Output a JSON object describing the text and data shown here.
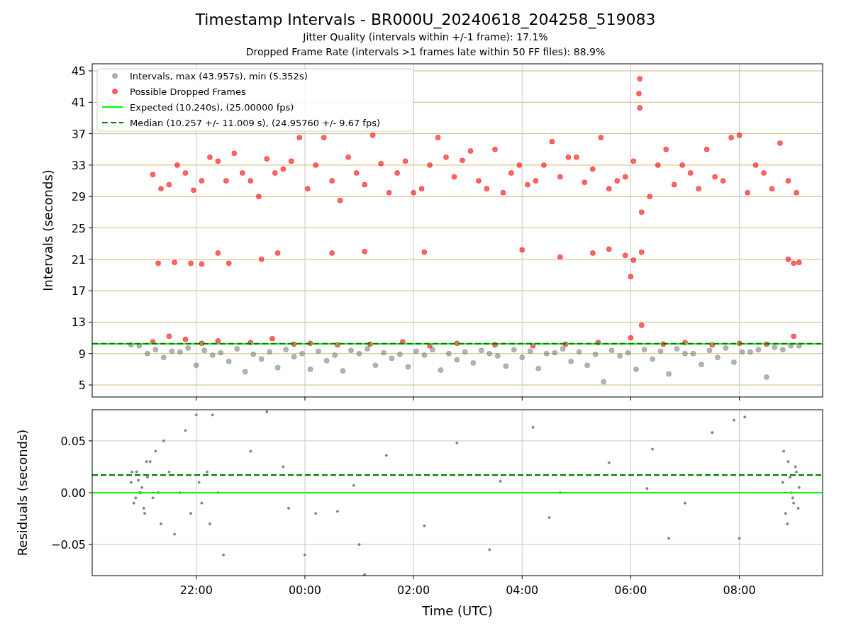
{
  "figure": {
    "title": "Timestamp Intervals - BR000U_20240618_204258_519083",
    "subtitles": [
      "Jitter Quality (intervals within +/-1 frame): 17.1%",
      "Dropped Frame Rate (intervals >1 frames late within 50 FF files): 88.9%"
    ],
    "charts": [
      {
        "chart_data": {
          "type": "scatter",
          "ylabel": "Intervals (seconds)",
          "grid": true,
          "xlim": [
            "2024-06-18T20:05",
            "2024-06-19T09:32"
          ],
          "ylim": [
            3.47,
            45.9
          ],
          "yticks": [
            {
              "value": 45,
              "label": "45"
            },
            {
              "value": 41,
              "label": "41"
            },
            {
              "value": 37,
              "label": "37"
            },
            {
              "value": 33,
              "label": "33"
            },
            {
              "value": 29,
              "label": "29"
            },
            {
              "value": 25,
              "label": "25"
            },
            {
              "value": 21,
              "label": "21"
            },
            {
              "value": 17,
              "label": "17"
            },
            {
              "value": 13,
              "label": "13"
            },
            {
              "value": 9,
              "label": "9"
            },
            {
              "value": 5,
              "label": "5"
            }
          ],
          "legend": true,
          "series": [
            {
              "name": "Intervals, max (43.957s), min (5.352s)",
              "type": "scatter",
              "color": "#808080",
              "x": [
                "2024-06-18T20:48",
                "2024-06-18T21:06",
                "2024-06-18T21:24",
                "2024-06-18T21:42",
                "2024-06-18T22:00",
                "2024-06-18T22:18",
                "2024-06-18T22:36",
                "2024-06-18T22:54",
                "2024-06-18T23:12",
                "2024-06-18T23:30",
                "2024-06-18T23:48",
                "2024-06-19T00:06",
                "2024-06-19T00:24",
                "2024-06-19T00:42",
                "2024-06-19T01:00",
                "2024-06-19T01:18",
                "2024-06-19T01:36",
                "2024-06-19T01:54",
                "2024-06-19T02:12",
                "2024-06-19T02:30",
                "2024-06-19T02:48",
                "2024-06-19T03:06",
                "2024-06-19T03:24",
                "2024-06-19T03:42",
                "2024-06-19T04:00",
                "2024-06-19T04:18",
                "2024-06-19T04:36",
                "2024-06-19T04:54",
                "2024-06-19T05:12",
                "2024-06-19T05:30",
                "2024-06-19T05:48",
                "2024-06-19T06:06",
                "2024-06-19T06:24",
                "2024-06-19T06:42",
                "2024-06-19T07:00",
                "2024-06-19T07:18",
                "2024-06-19T07:36",
                "2024-06-19T07:54",
                "2024-06-19T08:12",
                "2024-06-19T08:30",
                "2024-06-19T08:48",
                "2024-06-19T09:06",
                "2024-06-18T20:57",
                "2024-06-18T21:15",
                "2024-06-18T21:33",
                "2024-06-18T21:51",
                "2024-06-18T22:09",
                "2024-06-18T22:27",
                "2024-06-18T22:45",
                "2024-06-18T23:03",
                "2024-06-18T23:21",
                "2024-06-18T23:39",
                "2024-06-18T23:57",
                "2024-06-19T00:15",
                "2024-06-19T00:33",
                "2024-06-19T00:51",
                "2024-06-19T01:09",
                "2024-06-19T01:27",
                "2024-06-19T01:45",
                "2024-06-19T02:03",
                "2024-06-19T02:21",
                "2024-06-19T02:39",
                "2024-06-19T02:57",
                "2024-06-19T03:15",
                "2024-06-19T03:33",
                "2024-06-19T03:51",
                "2024-06-19T04:09",
                "2024-06-19T04:27",
                "2024-06-19T04:45",
                "2024-06-19T05:03",
                "2024-06-19T05:21",
                "2024-06-19T05:39",
                "2024-06-19T05:57",
                "2024-06-19T06:15",
                "2024-06-19T06:33",
                "2024-06-19T06:51",
                "2024-06-19T07:09",
                "2024-06-19T07:27",
                "2024-06-19T07:45",
                "2024-06-19T08:03",
                "2024-06-19T08:21",
                "2024-06-19T08:39",
                "2024-06-19T08:57"
              ],
              "values": [
                10.1,
                9.0,
                8.5,
                9.2,
                7.5,
                8.8,
                8.0,
                6.7,
                8.3,
                7.2,
                8.6,
                7.0,
                8.1,
                6.8,
                9.0,
                7.5,
                8.4,
                7.3,
                8.8,
                6.9,
                8.2,
                7.8,
                9.0,
                7.4,
                8.5,
                7.1,
                9.1,
                8.0,
                7.5,
                5.4,
                8.7,
                7.0,
                8.3,
                6.4,
                9.0,
                7.6,
                8.5,
                7.9,
                9.2,
                6.0,
                9.5,
                10.0,
                10.0,
                9.5,
                9.3,
                9.7,
                9.4,
                9.1,
                9.6,
                8.9,
                9.2,
                9.5,
                9.0,
                9.3,
                8.8,
                9.4,
                9.6,
                9.1,
                8.9,
                9.3,
                9.5,
                9.0,
                9.2,
                9.4,
                8.7,
                9.5,
                9.3,
                9.0,
                9.6,
                9.2,
                8.9,
                9.4,
                9.1,
                9.5,
                9.3,
                9.6,
                9.0,
                9.4,
                9.7,
                9.2,
                9.5,
                9.8,
                10.0
              ]
            },
            {
              "name": "Possible Dropped Frames",
              "type": "scatter",
              "color": "#ff0000",
              "x": [
                "2024-06-18T21:12",
                "2024-06-18T21:30",
                "2024-06-18T21:48",
                "2024-06-18T22:06",
                "2024-06-18T22:24",
                "2024-06-18T22:42",
                "2024-06-18T23:00",
                "2024-06-18T23:18",
                "2024-06-18T23:36",
                "2024-06-18T23:54",
                "2024-06-19T00:12",
                "2024-06-19T00:30",
                "2024-06-19T00:48",
                "2024-06-19T01:06",
                "2024-06-19T01:24",
                "2024-06-19T01:42",
                "2024-06-19T02:00",
                "2024-06-19T02:18",
                "2024-06-19T02:36",
                "2024-06-19T02:54",
                "2024-06-19T03:12",
                "2024-06-19T03:30",
                "2024-06-19T03:48",
                "2024-06-19T04:06",
                "2024-06-19T04:24",
                "2024-06-19T04:42",
                "2024-06-19T05:00",
                "2024-06-19T05:18",
                "2024-06-19T05:36",
                "2024-06-19T05:54",
                "2024-06-19T06:12",
                "2024-06-19T06:30",
                "2024-06-19T06:48",
                "2024-06-19T07:06",
                "2024-06-19T07:24",
                "2024-06-19T07:42",
                "2024-06-19T08:00",
                "2024-06-19T08:18",
                "2024-06-19T08:36",
                "2024-06-19T08:54",
                "2024-06-18T21:21",
                "2024-06-18T21:39",
                "2024-06-18T21:57",
                "2024-06-18T22:15",
                "2024-06-18T22:33",
                "2024-06-18T22:51",
                "2024-06-18T23:09",
                "2024-06-18T23:27",
                "2024-06-18T23:45",
                "2024-06-19T00:03",
                "2024-06-19T00:21",
                "2024-06-19T00:39",
                "2024-06-19T00:57",
                "2024-06-19T01:15",
                "2024-06-19T01:33",
                "2024-06-19T01:51",
                "2024-06-19T02:09",
                "2024-06-19T02:27",
                "2024-06-19T02:45",
                "2024-06-19T03:03",
                "2024-06-19T03:21",
                "2024-06-19T03:39",
                "2024-06-19T03:57",
                "2024-06-19T04:15",
                "2024-06-19T04:33",
                "2024-06-19T04:51",
                "2024-06-19T05:09",
                "2024-06-19T05:27",
                "2024-06-19T05:45",
                "2024-06-19T06:03",
                "2024-06-19T06:21",
                "2024-06-19T06:39",
                "2024-06-19T06:57",
                "2024-06-19T07:15",
                "2024-06-19T07:33",
                "2024-06-19T07:51",
                "2024-06-19T08:09",
                "2024-06-19T08:27",
                "2024-06-19T08:45",
                "2024-06-19T09:03",
                "2024-06-18T21:18",
                "2024-06-18T21:36",
                "2024-06-18T21:54",
                "2024-06-18T22:06",
                "2024-06-18T22:24",
                "2024-06-18T22:36",
                "2024-06-18T23:12",
                "2024-06-18T23:30",
                "2024-06-19T00:30",
                "2024-06-19T01:06",
                "2024-06-19T02:12",
                "2024-06-19T04:00",
                "2024-06-19T04:42",
                "2024-06-19T05:18",
                "2024-06-19T05:36",
                "2024-06-19T05:54",
                "2024-06-19T06:00",
                "2024-06-19T06:12",
                "2024-06-19T06:03",
                "2024-06-19T09:00",
                "2024-06-19T08:54",
                "2024-06-19T09:06",
                "2024-06-18T21:12",
                "2024-06-18T21:30",
                "2024-06-18T21:48",
                "2024-06-18T22:06",
                "2024-06-18T22:24",
                "2024-06-18T23:00",
                "2024-06-18T23:24",
                "2024-06-18T23:48",
                "2024-06-19T00:06",
                "2024-06-19T00:36",
                "2024-06-19T01:12",
                "2024-06-19T01:48",
                "2024-06-19T02:18",
                "2024-06-19T02:48",
                "2024-06-19T03:30",
                "2024-06-19T04:12",
                "2024-06-19T04:48",
                "2024-06-19T05:24",
                "2024-06-19T06:00",
                "2024-06-19T06:12",
                "2024-06-19T06:36",
                "2024-06-19T07:00",
                "2024-06-19T07:30",
                "2024-06-19T08:00",
                "2024-06-19T08:30",
                "2024-06-19T09:00",
                "2024-06-19T06:10",
                "2024-06-19T06:09",
                "2024-06-19T06:10"
              ],
              "values": [
                31.8,
                30.5,
                32.0,
                31.0,
                33.5,
                34.5,
                31.0,
                33.8,
                32.5,
                36.5,
                33.0,
                31.0,
                34.0,
                30.5,
                33.2,
                32.0,
                29.5,
                33.0,
                34.0,
                33.6,
                31.0,
                35.0,
                32.0,
                30.5,
                33.0,
                31.5,
                34.0,
                32.5,
                30.0,
                31.5,
                27.0,
                33.0,
                30.5,
                32.0,
                35.0,
                31.0,
                36.8,
                33.0,
                30.0,
                31.0,
                30,
                33,
                29.8,
                34,
                31,
                32,
                29,
                32,
                33.5,
                30,
                36.5,
                28.5,
                32,
                36.8,
                29.5,
                33.5,
                30,
                36.5,
                31.5,
                34.8,
                30,
                29.5,
                33,
                31,
                36,
                34,
                30.8,
                36.5,
                31,
                33.5,
                29,
                35,
                33,
                30,
                31.5,
                36.5,
                29.5,
                32,
                35.8,
                29.5,
                20.5,
                20.6,
                20.5,
                20.4,
                21.8,
                20.5,
                21.0,
                21.8,
                21.8,
                22.0,
                21.9,
                22.2,
                21.3,
                21.8,
                22.3,
                21.5,
                18.8,
                21.9,
                20.9,
                20.5,
                21.0,
                20.6,
                10.5,
                11.2,
                10.8,
                10.3,
                10.6,
                10.4,
                10.9,
                10.2,
                10.3,
                10.1,
                10.2,
                10.5,
                10.0,
                10.3,
                10.1,
                10.0,
                10.2,
                10.4,
                11.0,
                12.6,
                10.2,
                10.4,
                10.1,
                10.3,
                10.2,
                11.2,
                44.0,
                42.1,
                40.3
              ]
            },
            {
              "name": "Expected (10.240s), (25.00000 fps)",
              "type": "line",
              "color": "#00ff00",
              "x": [
                "2024-06-18T20:05",
                "2024-06-19T09:32"
              ],
              "values": [
                10.24,
                10.24
              ]
            },
            {
              "name": "Median (10.257 +/- 11.009 s), (24.95760 +/- 9.67 fps)",
              "type": "line",
              "line_style": "dashed",
              "color": "#008000",
              "x": [
                "2024-06-18T20:05",
                "2024-06-19T09:32"
              ],
              "values": [
                10.257,
                10.257
              ]
            }
          ]
        }
      },
      {
        "chart_data": {
          "type": "scatter",
          "ylabel": "Residuals (seconds)",
          "xlabel": "Time (UTC)",
          "grid": true,
          "xlim": [
            "2024-06-18T20:05",
            "2024-06-19T09:32"
          ],
          "ylim": [
            -0.08,
            0.08
          ],
          "xticks": [
            {
              "value": "2024-06-18T22:00",
              "label": "22:00"
            },
            {
              "value": "2024-06-19T00:00",
              "label": "00:00"
            },
            {
              "value": "2024-06-19T02:00",
              "label": "02:00"
            },
            {
              "value": "2024-06-19T04:00",
              "label": "04:00"
            },
            {
              "value": "2024-06-19T06:00",
              "label": "06:00"
            },
            {
              "value": "2024-06-19T08:00",
              "label": "08:00"
            }
          ],
          "yticks": [
            {
              "value": 0.05,
              "label": "0.05"
            },
            {
              "value": 0,
              "label": "0.00"
            },
            {
              "value": -0.05,
              "label": "−0.05"
            }
          ],
          "legend": false,
          "series": [
            {
              "type": "scatter",
              "color": "#808080",
              "x": [
                "2024-06-18T20:48",
                "2024-06-18T20:51",
                "2024-06-18T20:54",
                "2024-06-18T20:57",
                "2024-06-18T21:00",
                "2024-06-18T21:03",
                "2024-06-18T21:06",
                "2024-06-18T21:09",
                "2024-06-18T21:12",
                "2024-06-18T21:15",
                "2024-06-18T21:18",
                "2024-06-18T21:21",
                "2024-06-18T21:24",
                "2024-06-18T21:30",
                "2024-06-18T21:36",
                "2024-06-18T21:42",
                "2024-06-18T21:48",
                "2024-06-18T21:54",
                "2024-06-18T22:00",
                "2024-06-18T22:03",
                "2024-06-18T22:06",
                "2024-06-18T22:12",
                "2024-06-18T22:15",
                "2024-06-18T22:18",
                "2024-06-18T22:24",
                "2024-06-18T22:30",
                "2024-06-18T23:00",
                "2024-06-18T23:18",
                "2024-06-18T23:36",
                "2024-06-18T23:42",
                "2024-06-19T00:00",
                "2024-06-19T00:12",
                "2024-06-19T00:36",
                "2024-06-19T00:54",
                "2024-06-19T01:00",
                "2024-06-19T01:06",
                "2024-06-19T01:30",
                "2024-06-19T02:12",
                "2024-06-19T02:48",
                "2024-06-19T03:24",
                "2024-06-19T03:36",
                "2024-06-19T04:12",
                "2024-06-19T04:30",
                "2024-06-19T04:42",
                "2024-06-19T05:36",
                "2024-06-19T06:18",
                "2024-06-19T06:24",
                "2024-06-19T06:42",
                "2024-06-19T07:00",
                "2024-06-19T07:30",
                "2024-06-19T07:54",
                "2024-06-19T08:06",
                "2024-06-19T08:00",
                "2024-06-19T08:48",
                "2024-06-19T08:51",
                "2024-06-19T08:54",
                "2024-06-19T08:57",
                "2024-06-19T09:00",
                "2024-06-19T09:03",
                "2024-06-19T09:06",
                "2024-06-19T08:49",
                "2024-06-19T08:53",
                "2024-06-19T08:56",
                "2024-06-19T08:59",
                "2024-06-19T09:02",
                "2024-06-19T09:05",
                "2024-06-18T20:49",
                "2024-06-18T20:53",
                "2024-06-18T20:56",
                "2024-06-18T20:59",
                "2024-06-18T21:02",
                "2024-06-18T21:05"
              ],
              "values": [
                0.01,
                -0.01,
                0.02,
                0.0,
                0.005,
                -0.02,
                0.015,
                0.03,
                -0.005,
                0.04,
                0.0,
                -0.03,
                0.05,
                0.02,
                -0.04,
                0.0,
                0.06,
                -0.02,
                0.075,
                0.01,
                -0.01,
                0.02,
                -0.03,
                0.075,
                0.0,
                -0.06,
                0.04,
                0.078,
                0.025,
                -0.015,
                -0.06,
                -0.02,
                -0.018,
                0.007,
                -0.05,
                -0.079,
                0.036,
                -0.032,
                0.048,
                -0.055,
                0.011,
                0.063,
                -0.024,
                0.0,
                0.029,
                0.004,
                0.042,
                -0.044,
                -0.01,
                0.058,
                0.07,
                0.073,
                -0.044,
                0.01,
                -0.02,
                0.03,
                0.0,
                -0.01,
                0.02,
                0.005,
                0.04,
                -0.03,
                0.015,
                -0.005,
                0.025,
                -0.015,
                0.02,
                -0.005,
                0.012,
                0.0,
                -0.015,
                0.03
              ]
            },
            {
              "type": "line",
              "color": "#00ff00",
              "x": [
                "2024-06-18T20:05",
                "2024-06-19T09:32"
              ],
              "values": [
                0,
                0
              ]
            },
            {
              "type": "line",
              "line_style": "dashed",
              "color": "#008000",
              "x": [
                "2024-06-18T20:05",
                "2024-06-19T09:32"
              ],
              "values": [
                0.017,
                0.017
              ]
            }
          ]
        }
      }
    ]
  }
}
